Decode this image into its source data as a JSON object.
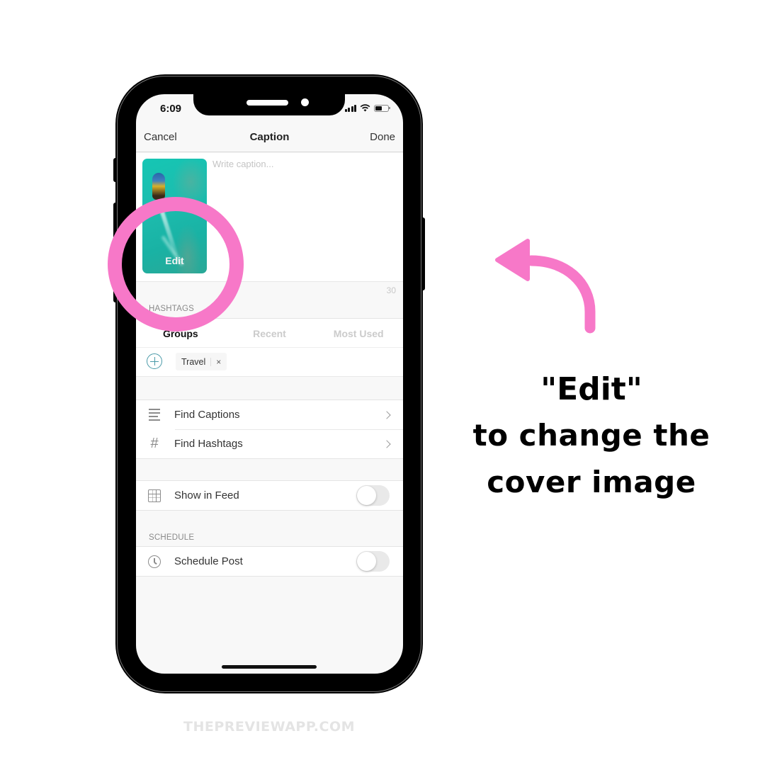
{
  "status_bar": {
    "time": "6:09",
    "icons": [
      "cellular-signal-icon",
      "wifi-icon",
      "battery-icon"
    ]
  },
  "navbar": {
    "cancel_label": "Cancel",
    "title": "Caption",
    "done_label": "Done"
  },
  "caption": {
    "thumbnail_edit_label": "Edit",
    "placeholder": "Write caption...",
    "value": "",
    "char_count": "30"
  },
  "hashtags": {
    "section_label": "HASHTAGS",
    "tabs": [
      {
        "label": "Groups",
        "active": true
      },
      {
        "label": "Recent",
        "active": false
      },
      {
        "label": "Most Used",
        "active": false
      }
    ],
    "add_icon": "plus-circle-icon",
    "chips": [
      {
        "label": "Travel",
        "remove_glyph": "×"
      }
    ]
  },
  "tools": {
    "items": [
      {
        "label": "Find Captions",
        "icon": "text-lines-icon"
      },
      {
        "label": "Find Hashtags",
        "icon": "hashtag-icon",
        "glyph": "#"
      }
    ]
  },
  "feed": {
    "items": [
      {
        "label": "Show in Feed",
        "icon": "grid-icon",
        "toggle_on": false
      }
    ]
  },
  "schedule": {
    "section_label": "SCHEDULE",
    "items": [
      {
        "label": "Schedule Post",
        "icon": "clock-icon",
        "toggle_on": false
      }
    ]
  },
  "annotation": {
    "line1": "\"Edit\"",
    "line2": "to change the",
    "line3": "cover image",
    "accent_color": "#f778c8"
  },
  "footer": {
    "watermark": "THEPREVIEWAPP.COM"
  }
}
